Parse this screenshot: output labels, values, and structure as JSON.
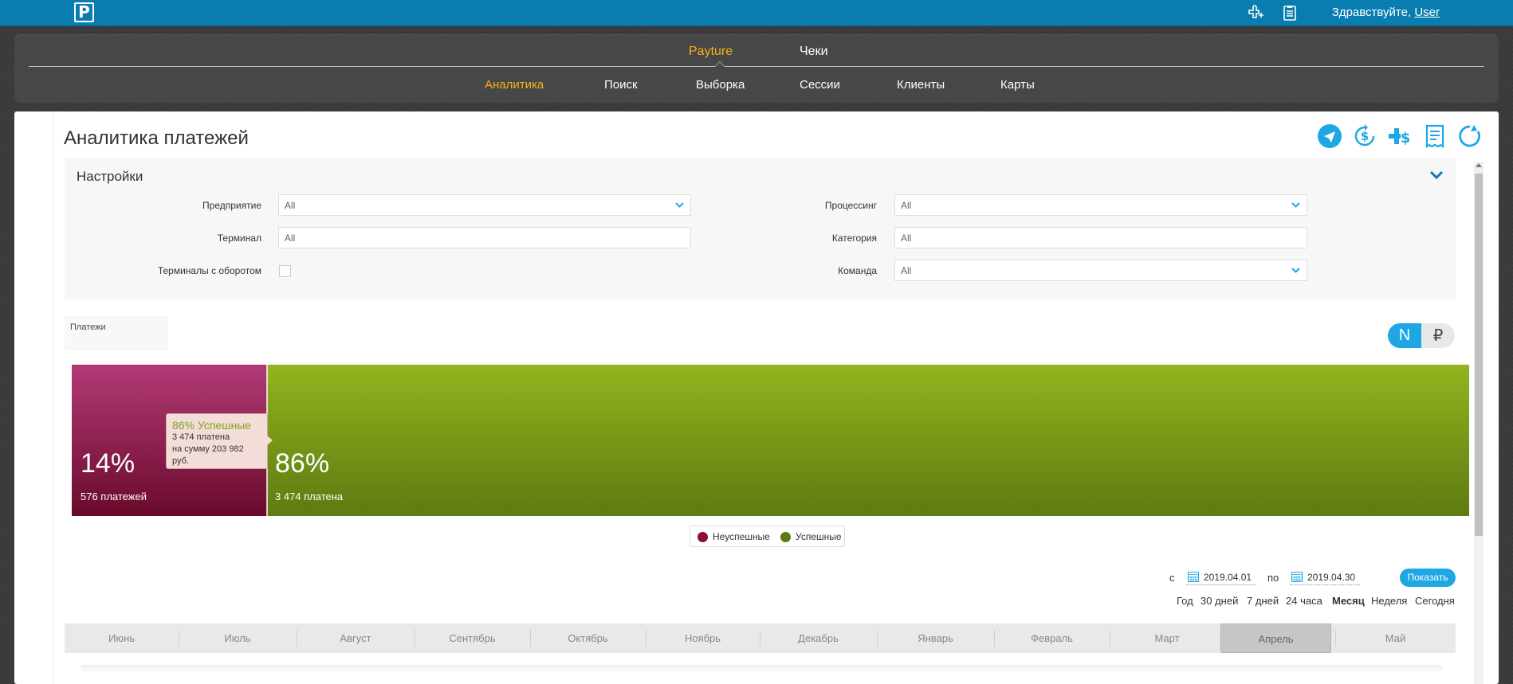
{
  "header": {
    "logo_letter": "P",
    "greeting_prefix": "Здравствуйте, ",
    "user_name": "User"
  },
  "nav": {
    "top_items": [
      {
        "label": "Payture",
        "active": true
      },
      {
        "label": "Чеки",
        "active": false
      }
    ],
    "sub_items": [
      {
        "label": "Аналитика",
        "active": true
      },
      {
        "label": "Поиск",
        "active": false
      },
      {
        "label": "Выборка",
        "active": false
      },
      {
        "label": "Сессии",
        "active": false
      },
      {
        "label": "Клиенты",
        "active": false
      },
      {
        "label": "Карты",
        "active": false
      }
    ]
  },
  "page": {
    "title": "Аналитика платежей",
    "actions": [
      "send-icon",
      "dollar-refresh-icon",
      "dollar-plus-icon",
      "receipt-icon",
      "refresh-icon"
    ]
  },
  "settings": {
    "title": "Настройки",
    "fields": {
      "enterprise": {
        "label": "Предприятие",
        "value": "All"
      },
      "terminal": {
        "label": "Терминал",
        "value": "All"
      },
      "turnover": {
        "label": "Терминалы с оборотом",
        "checked": false
      },
      "processing": {
        "label": "Процессинг",
        "value": "All"
      },
      "category": {
        "label": "Категория",
        "value": "All"
      },
      "command": {
        "label": "Команда",
        "value": "All"
      }
    }
  },
  "payments_tab": "Платежи",
  "toggle": {
    "count_label": "N",
    "amount_label": "₽",
    "selected": "N"
  },
  "chart_data": {
    "type": "bar",
    "stacked": "horizontal-100",
    "series": [
      {
        "name": "Неуспешные",
        "percent": 14,
        "count_label": "576 платежей",
        "color": "#8a1040"
      },
      {
        "name": "Успешные",
        "percent": 86,
        "count_label": "3 474 платена",
        "color": "#7a9c1a"
      }
    ],
    "tooltip": {
      "title": "86% Успешные",
      "line1": "3 474 платена",
      "line2": "на сумму 203 982 руб."
    },
    "legend": [
      "Неуспешные",
      "Успешные"
    ]
  },
  "date_range": {
    "from_label": "с",
    "from": "2019.04.01",
    "to_label": "по",
    "to": "2019.04.30",
    "show_button": "Показать"
  },
  "periods": [
    {
      "label": "Год",
      "active": false
    },
    {
      "label": "30 дней",
      "active": false
    },
    {
      "label": "7 дней",
      "active": false
    },
    {
      "label": "24 часа",
      "active": false
    },
    {
      "label": "Месяц",
      "active": true
    },
    {
      "label": "Неделя",
      "active": false
    },
    {
      "label": "Сегодня",
      "active": false
    }
  ],
  "months": [
    {
      "label": "Июнь",
      "active": false
    },
    {
      "label": "Июль",
      "active": false
    },
    {
      "label": "Август",
      "active": false
    },
    {
      "label": "Сентябрь",
      "active": false
    },
    {
      "label": "Октябрь",
      "active": false
    },
    {
      "label": "Ноябрь",
      "active": false
    },
    {
      "label": "Декабрь",
      "active": false
    },
    {
      "label": "Январь",
      "active": false
    },
    {
      "label": "Февраль",
      "active": false
    },
    {
      "label": "Март",
      "active": false
    },
    {
      "label": "Апрель",
      "active": true
    },
    {
      "label": "Май",
      "active": false
    }
  ],
  "colors": {
    "brand_blue": "#0a7db0",
    "accent_blue": "#1ea7e4",
    "nav_active": "#f5b21a",
    "fail": "#8a1040",
    "success": "#7a9c1a"
  }
}
